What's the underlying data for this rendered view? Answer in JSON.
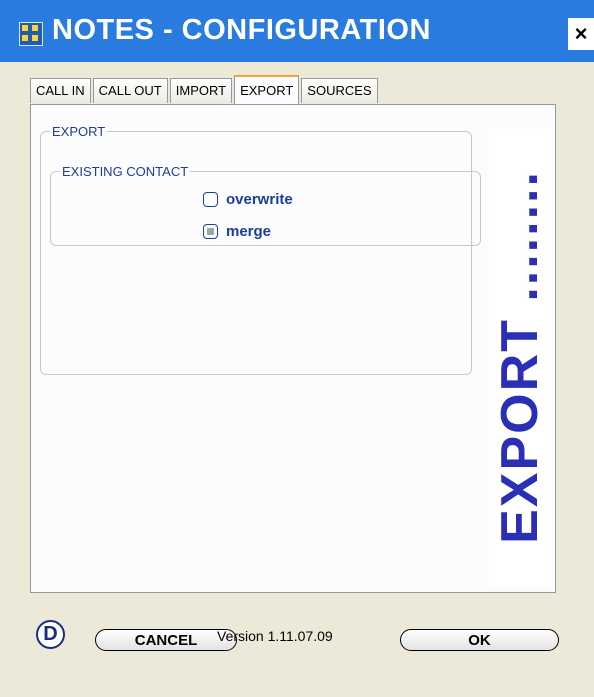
{
  "window": {
    "title": "NOTES - CONFIGURATION",
    "close_label": "×"
  },
  "tabs": [
    {
      "label": "CALL IN"
    },
    {
      "label": "CALL OUT"
    },
    {
      "label": "IMPORT"
    },
    {
      "label": "EXPORT"
    },
    {
      "label": "SOURCES"
    }
  ],
  "active_tab": "EXPORT",
  "export_panel": {
    "group_title": "EXPORT",
    "subgroup_title": "EXISTING CONTACT",
    "options": [
      {
        "label": "overwrite",
        "state": "unchecked"
      },
      {
        "label": "merge",
        "state": "indeterminate"
      }
    ],
    "banner_text": "EXPORT ........"
  },
  "footer": {
    "d_icon": "D",
    "cancel_label": "CANCEL",
    "version_text": "Version 1.11.07.09",
    "ok_label": "OK"
  },
  "colors": {
    "title_bar": "#2a7be0",
    "accent_text": "#1c3f94",
    "banner_text": "#2b2fb5",
    "logo_orange": "#f7a51b"
  },
  "icons": {
    "title": "address-book-icon",
    "logo": "orange-people-logo",
    "footer_left": "circle-d-icon"
  }
}
